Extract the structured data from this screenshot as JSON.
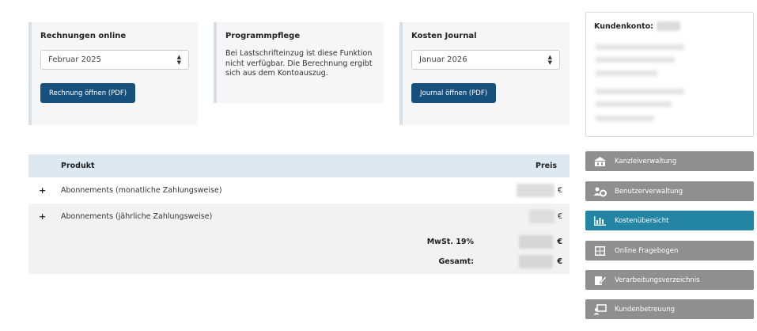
{
  "cards": {
    "invoices": {
      "title": "Rechnungen online",
      "select_value": "Februar 2025",
      "button_label": "Rechnung öffnen (PDF)"
    },
    "program": {
      "title": "Programmpflege",
      "text": "Bei Lastschrifteinzug ist diese Funktion nicht verfügbar. Die Berechnung ergibt sich aus dem Kontoauszug."
    },
    "journal": {
      "title": "Kosten Journal",
      "select_value": "Januar 2026",
      "button_label": "Journal öffnen (PDF)"
    }
  },
  "account": {
    "title": "Kundenkonto:"
  },
  "menu": [
    {
      "label": "Kanzleiverwaltung",
      "icon": "building-icon",
      "active": false
    },
    {
      "label": "Benutzerverwaltung",
      "icon": "users-gear-icon",
      "active": false
    },
    {
      "label": "Kostenübersicht",
      "icon": "bar-chart-icon",
      "active": true
    },
    {
      "label": "Online Fragebogen",
      "icon": "grid-icon",
      "active": false
    },
    {
      "label": "Verarbeitungsverzeichnis",
      "icon": "edit-document-icon",
      "active": false
    },
    {
      "label": "Kundenbetreuung",
      "icon": "support-icon",
      "active": false
    }
  ],
  "table": {
    "headers": {
      "product": "Produkt",
      "price": "Preis"
    },
    "rows": [
      {
        "expand": "+",
        "product": "Abonnements (monatliche Zahlungsweise)",
        "currency": "€"
      },
      {
        "expand": "+",
        "product": "Abonnements (jährliche Zahlungsweise)",
        "currency": "€"
      }
    ],
    "totals": {
      "vat_label": "MwSt. 19%",
      "total_label": "Gesamt:",
      "currency": "€"
    }
  },
  "colors": {
    "primary_button": "#16507d",
    "menu_active": "#2484a4",
    "menu_default": "#8f8f8f",
    "table_header": "#dde8f0"
  }
}
